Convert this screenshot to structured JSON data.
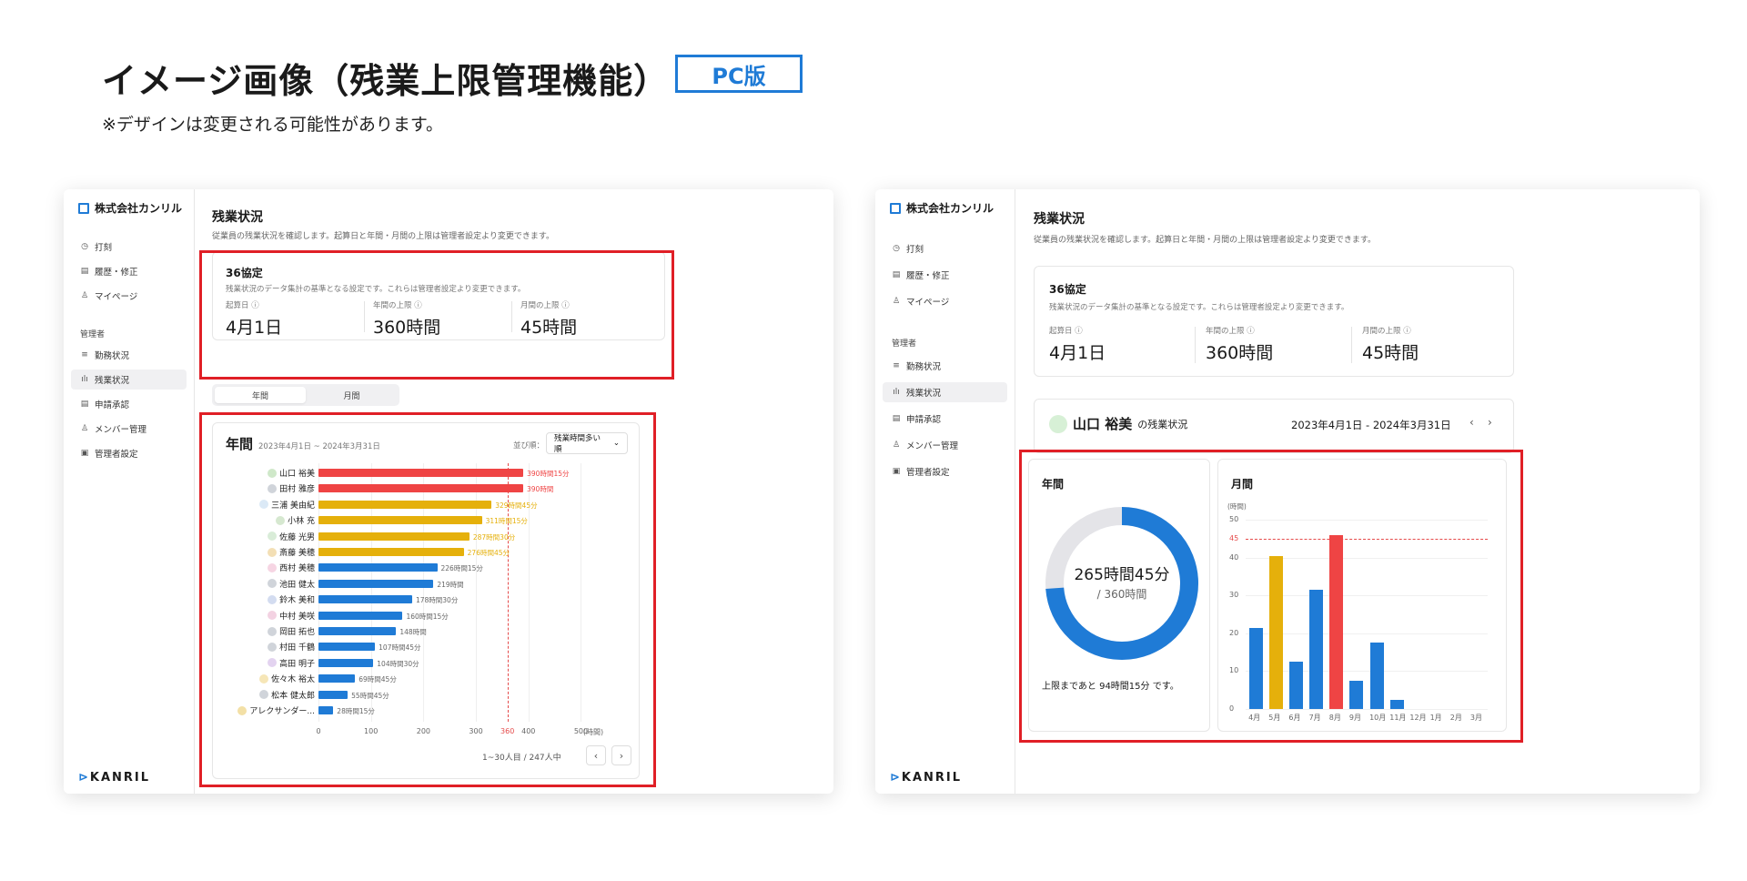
{
  "header": {
    "title": "イメージ画像（残業上限管理機能）",
    "badge": "PC版",
    "note": "※デザインは変更される可能性があります。"
  },
  "sidebar": {
    "company": "株式会社カンリル",
    "items": [
      {
        "label": "打刻",
        "icon": "clock-icon"
      },
      {
        "label": "履歴・修正",
        "icon": "document-icon"
      },
      {
        "label": "マイページ",
        "icon": "user-icon"
      }
    ],
    "admin_label": "管理者",
    "admin_items": [
      {
        "label": "勤務状況",
        "icon": "list-icon"
      },
      {
        "label": "残業状況",
        "icon": "bar-chart-icon"
      },
      {
        "label": "申請承認",
        "icon": "document-check-icon"
      },
      {
        "label": "メンバー管理",
        "icon": "users-icon"
      },
      {
        "label": "管理者設定",
        "icon": "settings-icon"
      }
    ],
    "logo": "KANRIL"
  },
  "page": {
    "title": "残業状況",
    "description": "従業員の残業状況を確認します。起算日と年間・月間の上限は管理者設定より変更できます。"
  },
  "agreement": {
    "title": "36協定",
    "description": "残業状況のデータ集計の基準となる設定です。これらは管理者設定より変更できます。",
    "stats": [
      {
        "label": "起算日 ⓘ",
        "value": "4月1日"
      },
      {
        "label": "年間の上限 ⓘ",
        "value": "360時間"
      },
      {
        "label": "月間の上限 ⓘ",
        "value": "45時間"
      }
    ]
  },
  "tabs": [
    "年間",
    "月間"
  ],
  "annual": {
    "title": "年間",
    "period": "2023年4月1日 ~ 2024年3月31日",
    "sort_label": "並び順：",
    "sort_value": "残業時間多い順",
    "pagination": "1~30人目 / 247人中",
    "axis_unit": "(時間)"
  },
  "member_detail": {
    "name": "山口 裕美",
    "suffix": "の残業状況",
    "period": "2023年4月1日 - 2024年3月31日",
    "annual_title": "年間",
    "annual_value": "265時間45分",
    "annual_limit": "/ 360時間",
    "remaining": "上限まであと 94時間15分 です。",
    "monthly_title": "月間",
    "monthly_unit": "(時間)"
  },
  "colors": {
    "red": "#ef4444",
    "yellow": "#e5b00b",
    "blue": "#1f7bd6",
    "donut_track": "#e4e4e8"
  },
  "chart_data": [
    {
      "type": "bar",
      "orientation": "horizontal",
      "title": "年間",
      "xlabel": "(時間)",
      "xlim": [
        0,
        520
      ],
      "ticks": [
        "0",
        "100",
        "200",
        "300",
        "360",
        "400",
        "500"
      ],
      "reference_line": 360,
      "categories": [
        "山口 裕美",
        "田村 雅彦",
        "三浦 美由紀",
        "小林 充",
        "佐藤 光男",
        "斎藤 美穂",
        "西村 美穂",
        "池田 健太",
        "鈴木 美和",
        "中村 美咲",
        "岡田 拓也",
        "村田 千鶴",
        "高田 明子",
        "佐々木 裕太",
        "松本 健太郎",
        "アレクサンダー..."
      ],
      "values": [
        390.25,
        390,
        329.75,
        311.25,
        287.5,
        276.75,
        226.25,
        219,
        178.5,
        160.25,
        148,
        107.75,
        104.5,
        69.75,
        55.75,
        28.25
      ],
      "labels": [
        "390時間15分",
        "390時間",
        "329時間45分",
        "311時間15分",
        "287時間30分",
        "276時間45分",
        "226時間15分",
        "219時間",
        "178時間30分",
        "160時間15分",
        "148時間",
        "107時間45分",
        "104時間30分",
        "69時間45分",
        "55時間45分",
        "28時間15分"
      ]
    },
    {
      "type": "pie",
      "title": "年間",
      "values": [
        265.75,
        94.25
      ],
      "labels": [
        "265時間45分",
        "残り"
      ],
      "total": 360
    },
    {
      "type": "bar",
      "title": "月間",
      "ylabel": "(時間)",
      "ylim": [
        0,
        50
      ],
      "yticks": [
        0,
        10,
        20,
        30,
        40,
        45,
        50
      ],
      "reference_line": 45,
      "categories": [
        "4月",
        "5月",
        "6月",
        "7月",
        "8月",
        "9月",
        "10月",
        "11月",
        "12月",
        "1月",
        "2月",
        "3月"
      ],
      "values": [
        21.5,
        40.5,
        12.5,
        31.5,
        46,
        7.5,
        17.5,
        2.5,
        0,
        0,
        0,
        0
      ]
    }
  ]
}
